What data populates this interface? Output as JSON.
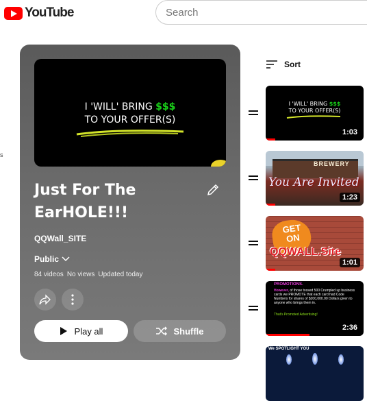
{
  "header": {
    "logo_text": "YouTube",
    "search_placeholder": "Search",
    "sidebar_fragment": "s"
  },
  "playlist": {
    "thumb_line1_prefix": "I 'WILL' BRING ",
    "thumb_line1_dollars": "$$$",
    "thumb_line2": "TO YOUR OFFER(S)",
    "title_line1": "Just For The",
    "title_line2": "EarHOLE!!!",
    "channel": "QQWall_SITE",
    "privacy": "Public",
    "video_count": "84 videos",
    "views": "No views",
    "updated": "Updated today",
    "play_all_label": "Play all",
    "shuffle_label": "Shuffle"
  },
  "sort_label": "Sort",
  "videos": [
    {
      "duration": "1:03",
      "progress_pct": 10,
      "line1_prefix": "I 'WILL' BRING ",
      "line1_dollars": "$$$",
      "line2": "TO YOUR OFFER(S)"
    },
    {
      "duration": "1:23",
      "progress_pct": 10,
      "sign_text": "BREWERY",
      "script_text": "You Are Invited"
    },
    {
      "duration": "1:01",
      "progress_pct": 10,
      "sign_text": "GET ON",
      "brand_text": "QQWALL.Site"
    },
    {
      "duration": "2:36",
      "progress_pct": 45,
      "heading": "PROMOTIONS.",
      "body_bold": "However,",
      "body_text": " of those tossed 500 Crumpled up business cards we PROMOTE that each card had Code Numbers for shares of $200,000.00 Dollars given to anyone who brings them in.",
      "footer": "That's Promoted Advertising!"
    },
    {
      "top_text": "We SPOTLIGHT YOU"
    }
  ],
  "colors": {
    "brand_red": "#ff0000",
    "dollar_green": "#19d219",
    "panel_gray": "#6b6b6b"
  }
}
